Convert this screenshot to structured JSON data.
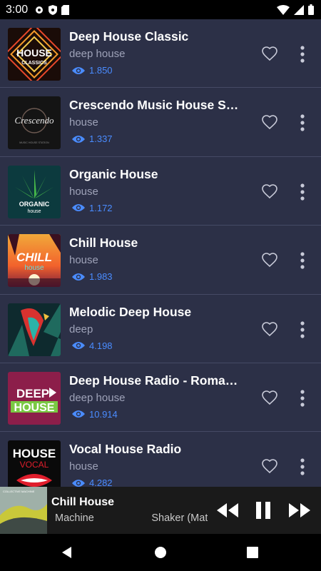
{
  "status_bar": {
    "time": "3:00"
  },
  "stations": [
    {
      "title": "Deep House Classic",
      "genre": "deep house",
      "views": "1.850",
      "artwork": "house-classics-art"
    },
    {
      "title": "Crescendo Music House Stati",
      "genre": "house",
      "views": "1.337",
      "artwork": "crescendo-art"
    },
    {
      "title": "Organic House",
      "genre": "house",
      "views": "1.172",
      "artwork": "organic-house-art"
    },
    {
      "title": "Chill House",
      "genre": "house",
      "views": "1.983",
      "artwork": "chill-house-art"
    },
    {
      "title": "Melodic Deep House",
      "genre": "deep",
      "views": "4.198",
      "artwork": "parrot-art"
    },
    {
      "title": "Deep House Radio - Romania",
      "genre": "deep house",
      "views": "10.914",
      "artwork": "deep-house-art"
    },
    {
      "title": "Vocal House Radio",
      "genre": "house",
      "views": "4.282",
      "artwork": "house-vocal-art"
    }
  ],
  "artwork_text": {
    "house_classics": [
      "HOUSE",
      "CLASSICS"
    ],
    "crescendo": "Crescendo",
    "crescendo_sub": "MUSIC HOUSE STATION",
    "organic": [
      "ORGANIC",
      "house"
    ],
    "chill": [
      "CHILL",
      "house"
    ],
    "deep_house": [
      "DEEP",
      "HOUSE"
    ],
    "vocal": [
      "HOUSE",
      "VOCAL"
    ]
  },
  "player": {
    "title": "Chill House",
    "subtitle": "Machine                    Shaker (Matt",
    "art_label": "COLLECTIVE MACHINE"
  },
  "colors": {
    "accent": "#4a8cff",
    "background": "#2c3047",
    "divider": "#454a65"
  }
}
